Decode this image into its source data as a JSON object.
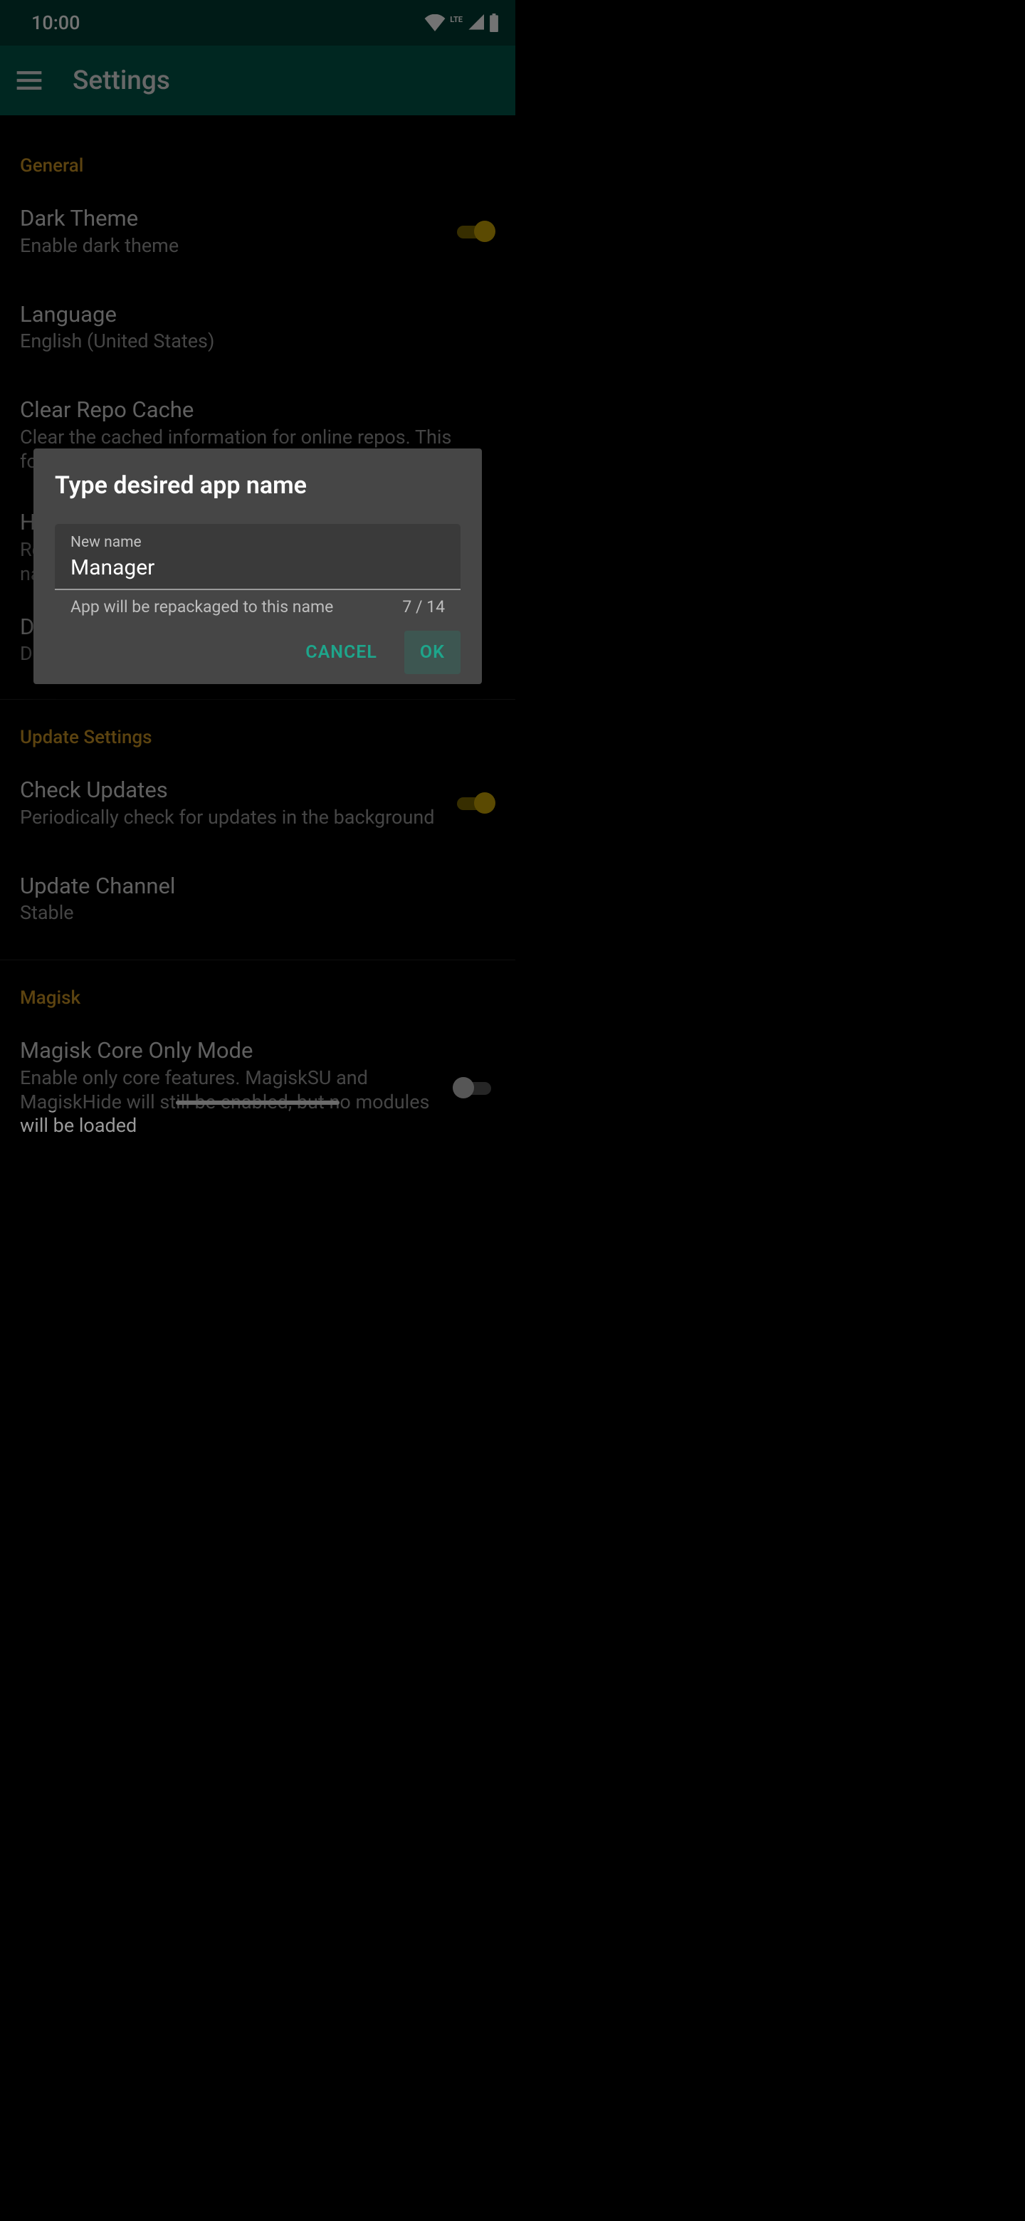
{
  "status": {
    "time": "10:00",
    "lte_label": "LTE"
  },
  "appbar": {
    "title": "Settings"
  },
  "sections": {
    "general": {
      "header": "General",
      "dark_theme": {
        "title": "Dark Theme",
        "sub": "Enable dark theme"
      },
      "language": {
        "title": "Language",
        "sub": "English (United States)"
      },
      "clear_repo": {
        "title": "Clear Repo Cache",
        "sub": "Clear the cached information for online repos. This forces the app to refresh online"
      },
      "hide": {
        "title": "H",
        "sub": "Re\nna"
      },
      "download": {
        "title": "D",
        "sub": "De"
      }
    },
    "update": {
      "header": "Update Settings",
      "check_updates": {
        "title": "Check Updates",
        "sub": "Periodically check for updates in the background"
      },
      "update_channel": {
        "title": "Update Channel",
        "sub": "Stable"
      }
    },
    "magisk": {
      "header": "Magisk",
      "core_only": {
        "title": "Magisk Core Only Mode",
        "sub": "Enable only core features. MagiskSU and MagiskHide will still be enabled, but no modules will be loaded"
      }
    }
  },
  "dialog": {
    "title": "Type desired app name",
    "label": "New name",
    "value": "Manager",
    "helper": "App will be repackaged to this name",
    "counter": "7 / 14",
    "cancel": "CANCEL",
    "ok": "OK"
  }
}
